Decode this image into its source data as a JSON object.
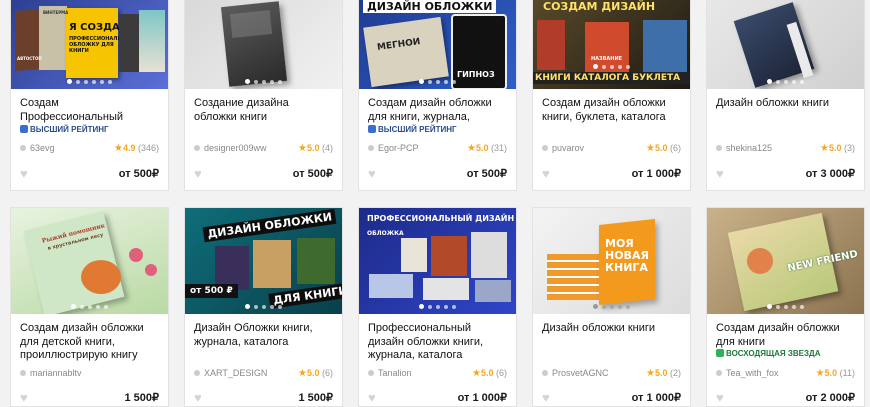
{
  "cards": [
    {
      "title": "Создам Профессиональный Дизайн Обложки книги,",
      "badge": "ВЫСШИЙ РЕЙТИНГ",
      "badge_type": "blue",
      "seller": "63evg",
      "rating": "4.9",
      "reviews": "(346)",
      "price": "от 500₽",
      "image": {
        "label": "Я СОЗДАМ",
        "sub": "ПРОФЕССИОНАЛЬНУЮ ОБЛОЖКУ ДЛЯ КНИГИ",
        "alt": "ВИНТЕРМА",
        "corner": "АВТОСТОП"
      }
    },
    {
      "title": "Создание дизайна обложки книги",
      "badge": "",
      "badge_type": "",
      "seller": "designer009ww",
      "rating": "5.0",
      "reviews": "(4)",
      "price": "от 500₽",
      "image": {
        "label": ""
      }
    },
    {
      "title": "Создам дизайн обложки для книги, журнала, каталога,",
      "badge": "ВЫСШИЙ РЕЙТИНГ",
      "badge_type": "blue",
      "seller": "Egor-PCP",
      "rating": "5.0",
      "reviews": "(31)",
      "price": "от 500₽",
      "image": {
        "label": "ДИЗАЙН ОБЛОЖКИ",
        "book1": "МЕГНОИ",
        "book2": "ГИПНОЗ"
      }
    },
    {
      "title": "Создам дизайн обложки книги, буклета, каталога",
      "badge": "",
      "badge_type": "",
      "seller": "puvarov",
      "rating": "5.0",
      "reviews": "(6)",
      "price": "от 1 000₽",
      "image": {
        "label": "СОЗДАМ ДИЗАЙН",
        "sub": "КНИГИ КАТАЛОГА БУКЛЕТА",
        "book": "НАЗВАНИЕ"
      }
    },
    {
      "title": "Дизайн обложки книги",
      "badge": "",
      "badge_type": "",
      "seller": "shekina125",
      "rating": "5.0",
      "reviews": "(3)",
      "price": "от 3 000₽",
      "image": {
        "label": ""
      }
    },
    {
      "title": "Создам дизайн обложки для детской книги, проиллюстрирую книгу",
      "badge": "",
      "badge_type": "",
      "seller": "mariannabltv",
      "rating": "",
      "reviews": "",
      "price": "1 500₽",
      "image": {
        "label": "Рыжий помощник",
        "sub": "в хрустальном лесу"
      }
    },
    {
      "title": "Дизайн Обложки книги, журнала, каталога",
      "badge": "",
      "badge_type": "",
      "seller": "XART_DESIGN",
      "rating": "5.0",
      "reviews": "(6)",
      "price": "1 500₽",
      "image": {
        "label": "ДИЗАЙН ОБЛОЖКИ",
        "price_tag": "от 500 ₽",
        "sub": "ДЛЯ КНИГИ"
      }
    },
    {
      "title": "Профессиональный дизайн обложки книги, журнала, каталога",
      "badge": "",
      "badge_type": "",
      "seller": "Tanalion",
      "rating": "5.0",
      "reviews": "(6)",
      "price": "от 1 000₽",
      "image": {
        "label": "ПРОФЕССИОНАЛЬНЫЙ ДИЗАЙН",
        "sub": "ОБЛОЖКА"
      }
    },
    {
      "title": "Дизайн обложки книги",
      "badge": "",
      "badge_type": "",
      "seller": "ProsvetAGNC",
      "rating": "5.0",
      "reviews": "(2)",
      "price": "от 1 000₽",
      "image": {
        "label": "МОЯ НОВАЯ КНИГА"
      }
    },
    {
      "title": "Создам дизайн обложки для книги",
      "badge": "ВОСХОДЯЩАЯ ЗВЕЗДА",
      "badge_type": "green",
      "seller": "Tea_with_fox",
      "rating": "5.0",
      "reviews": "(11)",
      "price": "от 2 000₽",
      "image": {
        "label": "NEW FRIEND"
      }
    }
  ]
}
